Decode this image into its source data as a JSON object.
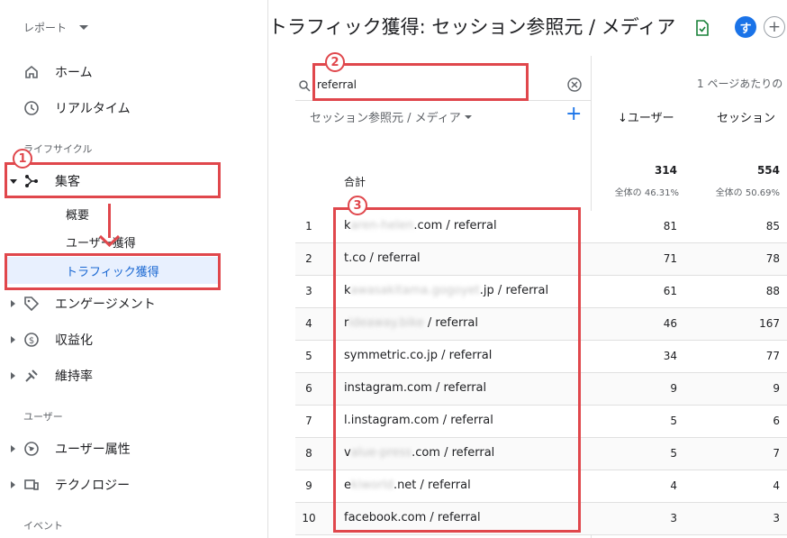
{
  "sidebar": {
    "report_selector": "レポート",
    "home": "ホーム",
    "realtime": "リアルタイム",
    "section_lifecycle": "ライフサイクル",
    "acquisition": "集客",
    "sub_overview": "概要",
    "sub_user_acq": "ユーザー獲得",
    "sub_traffic_acq": "トラフィック獲得",
    "engagement": "エンゲージメント",
    "monetization": "収益化",
    "retention": "維持率",
    "section_user": "ユーザー",
    "user_attributes": "ユーザー属性",
    "technology": "テクノロジー",
    "section_event": "イベント"
  },
  "header": {
    "title": "トラフィック獲得: セッション参照元 / メディア",
    "avatar": "す",
    "add": "+"
  },
  "table": {
    "search_value": "referral",
    "rows_per_page": "1 ページあたりの",
    "dimension_header": "セッション参照元 / メディア",
    "col_users": "↓ユーザー",
    "col_sessions": "セッション",
    "total_label": "合計",
    "total_users": "314",
    "total_users_pct": "全体の 46.31%",
    "total_sessions": "554",
    "total_sessions_pct": "全体の 50.69%",
    "rows": [
      {
        "num": "1",
        "pre": "k",
        "blur": "aren-helen",
        "post": ".com / referral",
        "users": "81",
        "sessions": "85"
      },
      {
        "num": "2",
        "pre": "t.co / referral",
        "blur": "",
        "post": "",
        "users": "71",
        "sessions": "78"
      },
      {
        "num": "3",
        "pre": "k",
        "blur": "awasakitama.gogoyet",
        "post": ".jp / referral",
        "users": "61",
        "sessions": "88"
      },
      {
        "num": "4",
        "pre": "r",
        "blur": "ideaway.bike",
        "post": " / referral",
        "users": "46",
        "sessions": "167"
      },
      {
        "num": "5",
        "pre": "symmetric.co.jp / referral",
        "blur": "",
        "post": "",
        "users": "34",
        "sessions": "77"
      },
      {
        "num": "6",
        "pre": "instagram.com / referral",
        "blur": "",
        "post": "",
        "users": "9",
        "sessions": "9"
      },
      {
        "num": "7",
        "pre": "l.instagram.com / referral",
        "blur": "",
        "post": "",
        "users": "5",
        "sessions": "6"
      },
      {
        "num": "8",
        "pre": "v",
        "blur": "alue-press",
        "post": ".com / referral",
        "users": "5",
        "sessions": "7"
      },
      {
        "num": "9",
        "pre": "e",
        "blur": "kiworld",
        "post": ".net / referral",
        "users": "4",
        "sessions": "4"
      },
      {
        "num": "10",
        "pre": "facebook.com / referral",
        "blur": "",
        "post": "",
        "users": "3",
        "sessions": "3"
      }
    ]
  },
  "annotations": {
    "badge1": "1",
    "badge2": "2",
    "badge3": "3",
    "color": "#e0474c"
  }
}
